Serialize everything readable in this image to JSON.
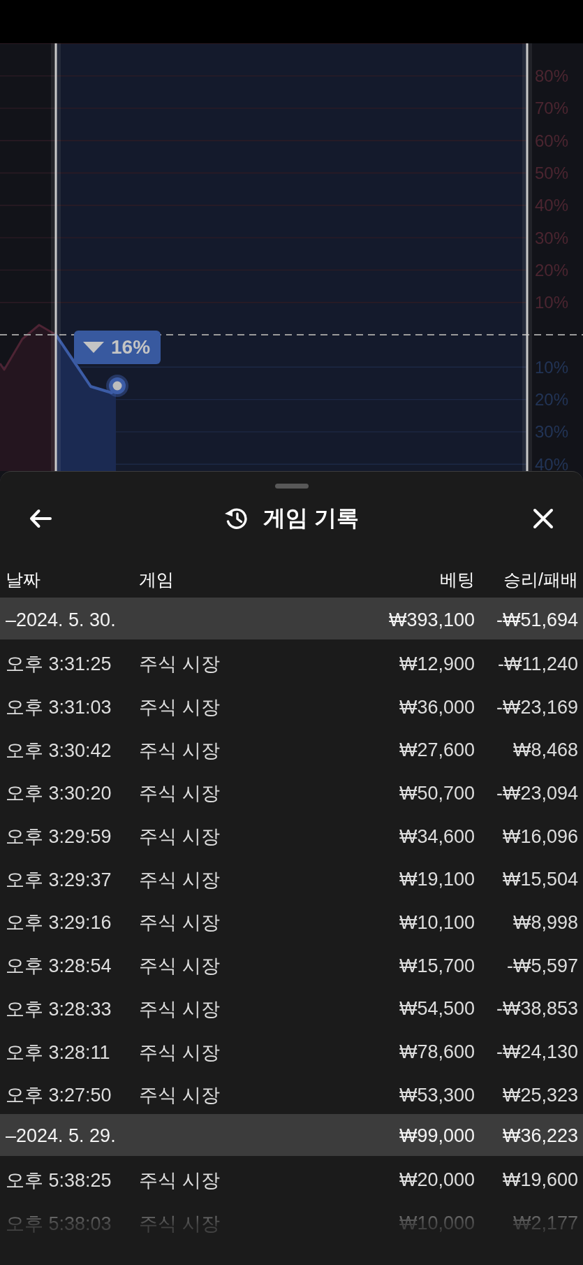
{
  "chart": {
    "axis_labels": [
      {
        "label": "80%",
        "kind": "rise"
      },
      {
        "label": "70%",
        "kind": "rise"
      },
      {
        "label": "60%",
        "kind": "rise"
      },
      {
        "label": "50%",
        "kind": "rise"
      },
      {
        "label": "40%",
        "kind": "rise"
      },
      {
        "label": "30%",
        "kind": "rise"
      },
      {
        "label": "20%",
        "kind": "rise"
      },
      {
        "label": "10%",
        "kind": "rise"
      },
      {
        "label": "10%",
        "kind": "fall"
      },
      {
        "label": "20%",
        "kind": "fall"
      },
      {
        "label": "30%",
        "kind": "fall"
      },
      {
        "label": "40%",
        "kind": "fall"
      }
    ],
    "badge": {
      "text": "16%",
      "kind": "fall"
    }
  },
  "sheet": {
    "title": "게임 기록",
    "columns": [
      "날짜",
      "게임",
      "베팅",
      "승리/패배"
    ],
    "groups": [
      {
        "date": "–2024. 5. 30.",
        "bet": "₩393,100",
        "result": "-₩51,694",
        "rows": [
          {
            "time": "오후 3:31:25",
            "game": "주식 시장",
            "bet": "₩12,900",
            "result": "-₩11,240"
          },
          {
            "time": "오후 3:31:03",
            "game": "주식 시장",
            "bet": "₩36,000",
            "result": "-₩23,169"
          },
          {
            "time": "오후 3:30:42",
            "game": "주식 시장",
            "bet": "₩27,600",
            "result": "₩8,468"
          },
          {
            "time": "오후 3:30:20",
            "game": "주식 시장",
            "bet": "₩50,700",
            "result": "-₩23,094"
          },
          {
            "time": "오후 3:29:59",
            "game": "주식 시장",
            "bet": "₩34,600",
            "result": "₩16,096"
          },
          {
            "time": "오후 3:29:37",
            "game": "주식 시장",
            "bet": "₩19,100",
            "result": "₩15,504"
          },
          {
            "time": "오후 3:29:16",
            "game": "주식 시장",
            "bet": "₩10,100",
            "result": "₩8,998"
          },
          {
            "time": "오후 3:28:54",
            "game": "주식 시장",
            "bet": "₩15,700",
            "result": "-₩5,597"
          },
          {
            "time": "오후 3:28:33",
            "game": "주식 시장",
            "bet": "₩54,500",
            "result": "-₩38,853"
          },
          {
            "time": "오후 3:28:11",
            "game": "주식 시장",
            "bet": "₩78,600",
            "result": "-₩24,130"
          },
          {
            "time": "오후 3:27:50",
            "game": "주식 시장",
            "bet": "₩53,300",
            "result": "₩25,323"
          }
        ]
      },
      {
        "date": "–2024. 5. 29.",
        "bet": "₩99,000",
        "result": "₩36,223",
        "rows": [
          {
            "time": "오후 5:38:25",
            "game": "주식 시장",
            "bet": "₩20,000",
            "result": "₩19,600"
          },
          {
            "time": "오후 5:38:03",
            "game": "주식 시장",
            "bet": "₩10,000",
            "result": "₩2,177"
          }
        ]
      }
    ]
  }
}
